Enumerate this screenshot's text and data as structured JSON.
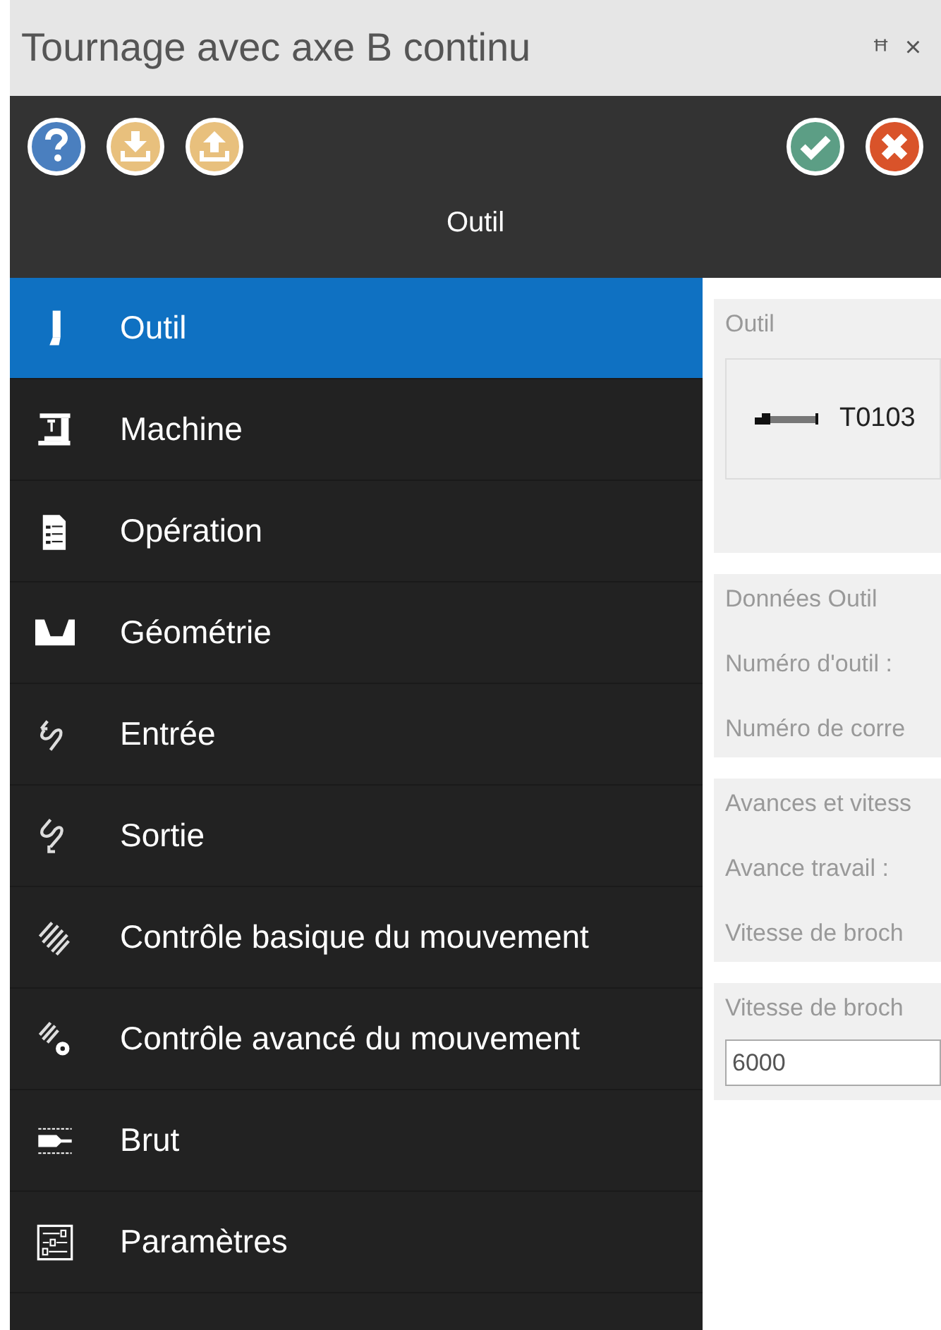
{
  "window": {
    "title": "Tournage avec axe B continu",
    "pin": "ꟸ",
    "close": "×"
  },
  "toolbar": {
    "title": "Outil"
  },
  "sidebar": {
    "items": [
      {
        "label": "Outil",
        "selected": true
      },
      {
        "label": "Machine",
        "selected": false
      },
      {
        "label": "Opération",
        "selected": false
      },
      {
        "label": "Géométrie",
        "selected": false
      },
      {
        "label": "Entrée",
        "selected": false
      },
      {
        "label": "Sortie",
        "selected": false
      },
      {
        "label": "Contrôle basique du mouvement",
        "selected": false
      },
      {
        "label": "Contrôle avancé du mouvement",
        "selected": false
      },
      {
        "label": "Brut",
        "selected": false
      },
      {
        "label": "Paramètres",
        "selected": false
      }
    ]
  },
  "panel": {
    "sections": [
      {
        "kind": "tool",
        "title": "Outil",
        "tool": "T0103"
      },
      {
        "kind": "list",
        "title": "Données Outil",
        "lines": [
          "Numéro d'outil :",
          "Numéro de corre"
        ]
      },
      {
        "kind": "list",
        "title": "Avances et vitess",
        "lines": [
          "Avance travail :",
          "Vitesse de broch"
        ]
      },
      {
        "kind": "field",
        "title": "Vitesse de broch",
        "value": "6000"
      }
    ]
  }
}
